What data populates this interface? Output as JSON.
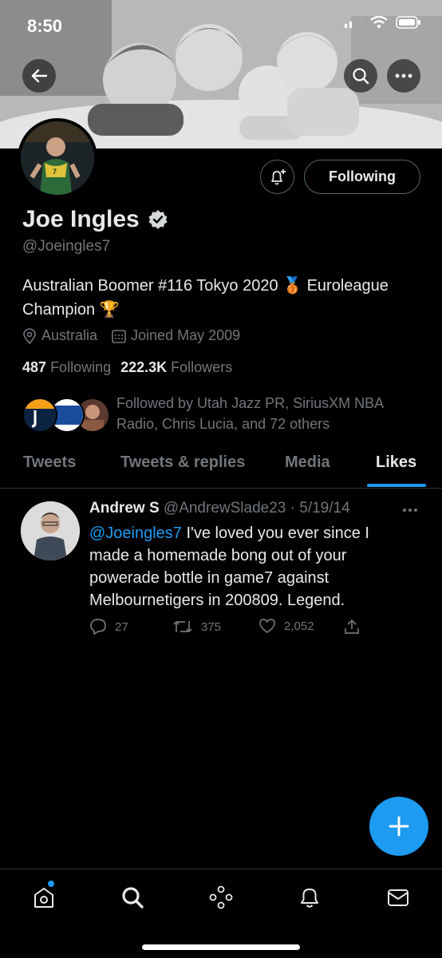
{
  "status_bar": {
    "time": "8:50"
  },
  "profile": {
    "name": "Joe Ingles",
    "handle": "@Joeingles7",
    "bio_line1": "Australian Boomer #116 Tokyo 2020 🥉 Euroleague",
    "bio_line2": "Champion 🏆",
    "location": "Australia",
    "joined": "Joined May 2009",
    "following_count": "487",
    "following_label": "Following",
    "followers_count": "222.3K",
    "followers_label": "Followers",
    "followed_by_line1": "Followed by Utah Jazz PR, SiriusXM NBA",
    "followed_by_line2": "Radio, Chris Lucia, and 72 others",
    "follow_button": "Following"
  },
  "tabs": [
    "Tweets",
    "Tweets & replies",
    "Media",
    "Likes"
  ],
  "active_tab": "Likes",
  "tweet": {
    "author": "Andrew S",
    "handle": "@AndrewSlade23",
    "date": "· 5/19/14",
    "mention": "@Joeingles7",
    "text_line1": " I've loved you ever since I",
    "text_line2": "made a homemade bong out of your",
    "text_line3": "powerade bottle in game7 against",
    "text_line4": "Melbournetigers in 200809. Legend.",
    "replies": "27",
    "retweets": "375",
    "likes": "2,052"
  },
  "colors": {
    "accent": "#1d9bf0",
    "muted": "#71767b",
    "text": "#e7e9ea",
    "border": "#2f3336"
  },
  "icons": [
    "back-arrow-icon",
    "search-icon",
    "more-icon",
    "bell-plus-icon",
    "verified-icon",
    "location-icon",
    "calendar-icon",
    "reply-icon",
    "retweet-icon",
    "like-icon",
    "share-icon",
    "compose-plus-icon",
    "home-icon",
    "spaces-icon",
    "notifications-icon",
    "messages-icon"
  ]
}
